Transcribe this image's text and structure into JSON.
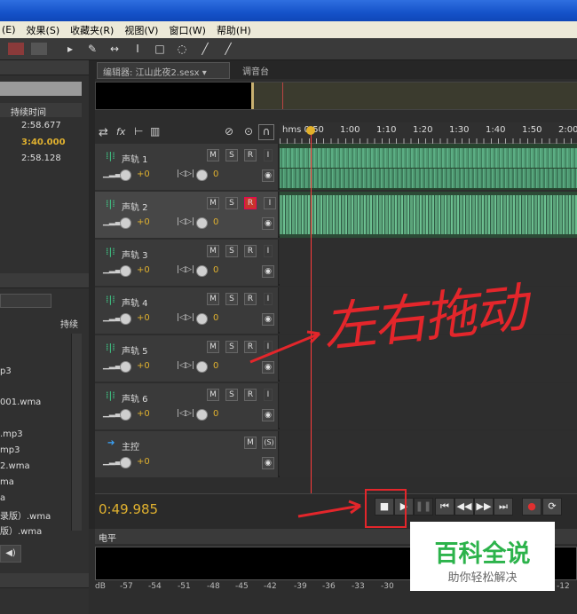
{
  "menu": [
    "(E)",
    "效果(S)",
    "收藏夹(R)",
    "视图(V)",
    "窗口(W)",
    "帮助(H)"
  ],
  "files_panel": {
    "column_header": "持续时间",
    "durations": [
      "2:58.677",
      "3:40.000",
      "2:58.128"
    ],
    "list_header": "持续",
    "file_items": [
      "p3",
      "001.wma",
      ".mp3",
      "mp3",
      "2.wma",
      "ma",
      "a",
      "录版）.wma",
      "版）.wma"
    ]
  },
  "editor": {
    "tab_editor": "编辑器: 江山此夜2.sesx",
    "tab_mixer": "调音台",
    "ruler_labels": [
      "hms 0:50",
      "1:00",
      "1:10",
      "1:20",
      "1:30",
      "1:40",
      "1:50",
      "2:00"
    ],
    "tracks": [
      {
        "name": "声轨 1",
        "vol": "+0",
        "pan": "0",
        "r_armed": false
      },
      {
        "name": "声轨 2",
        "vol": "+0",
        "pan": "0",
        "r_armed": true
      },
      {
        "name": "声轨 3",
        "vol": "+0",
        "pan": "0",
        "r_armed": false
      },
      {
        "name": "声轨 4",
        "vol": "+0",
        "pan": "0",
        "r_armed": false
      },
      {
        "name": "声轨 5",
        "vol": "+0",
        "pan": "0",
        "r_armed": false
      },
      {
        "name": "声轨 6",
        "vol": "+0",
        "pan": "0",
        "r_armed": false
      }
    ],
    "master": {
      "name": "主控",
      "vol": "+0"
    },
    "btn_m": "M",
    "btn_s": "S",
    "btn_r": "R",
    "btn_i": "I",
    "btn_ms": "(S)",
    "timecode": "0:49.985"
  },
  "level_panel": {
    "title": "电平",
    "db_labels": [
      "dB",
      "-57",
      "-54",
      "-51",
      "-48",
      "-45",
      "-42",
      "-39",
      "-36",
      "-33",
      "-30",
      "-12"
    ]
  },
  "annotation": {
    "text": "左右拖动"
  },
  "watermark": {
    "main": "百科全说",
    "sub": "助你轻松解决"
  },
  "colors": {
    "accent": "#e0b12f",
    "wave": "#4f9a72",
    "red": "#e3262b",
    "titlebar": "#1552c9"
  }
}
